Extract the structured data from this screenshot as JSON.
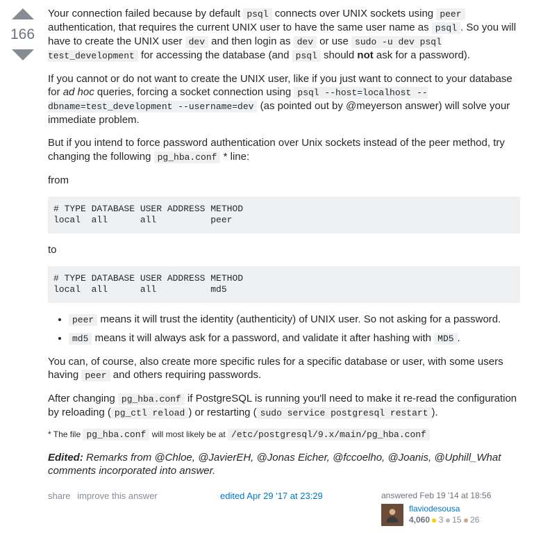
{
  "vote": {
    "count": "166"
  },
  "body": {
    "p1_a": "Your connection failed because by default ",
    "p1_b": " connects over UNIX sockets using ",
    "p1_c": " authentication, that requires the current UNIX user to have the same user name as ",
    "p1_d": ". So you will have to create the UNIX user ",
    "p1_e": " and then login as ",
    "p1_f": " or use ",
    "p1_g": " for accessing the database (and ",
    "p1_h": " should ",
    "p1_not": "not",
    "p1_i": " ask for a password).",
    "p2_a": "If you cannot or do not want to create the UNIX user, like if you just want to connect to your database for ",
    "p2_adhoc": "ad hoc",
    "p2_b": " queries, forcing a socket connection using ",
    "p2_c": " (as pointed out by @meyerson answer) will solve your immediate problem.",
    "p3_a": "But if you intend to force password authentication over Unix sockets instead of the peer method, try changing the following ",
    "p3_b": " * line:",
    "from": "from",
    "to": "to",
    "li1_a": " means it will trust the identity (authenticity) of UNIX user. So not asking for a password.",
    "li2_a": " means it will always ask for a password, and validate it after hashing with ",
    "li2_b": ".",
    "p4_a": "You can, of course, also create more specific rules for a specific database or user, with some users having ",
    "p4_b": " and others requiring passwords.",
    "p5_a": "After changing ",
    "p5_b": " if PostgreSQL is running you'll need to make it re-read the configuration by reloading (",
    "p5_c": ") or restarting (",
    "p5_d": ").",
    "note_a": "* The file ",
    "note_b": " will most likely be at ",
    "edited_label": "Edited:",
    "edited_text": " Remarks from @Chloe, @JavierEH, @Jonas Eicher, @fccoelho, @Joanis, @Uphill_What comments incorporated into answer."
  },
  "codes": {
    "psql": "psql",
    "peer": "peer",
    "dev": "dev",
    "sudo": "sudo -u dev psql test_development",
    "longhost": "psql --host=localhost --dbname=test_development --username=dev",
    "pghba": "pg_hba.conf",
    "md5u": "MD5",
    "md5l": "md5",
    "pgctl": "pg_ctl reload",
    "restart": "sudo service postgresql restart",
    "path": "/etc/postgresql/9.x/main/pg_hba.conf"
  },
  "pre": {
    "from": "# TYPE DATABASE USER ADDRESS METHOD\nlocal  all      all          peer",
    "to": "# TYPE DATABASE USER ADDRESS METHOD\nlocal  all      all          md5"
  },
  "actions": {
    "share": "share",
    "improve": "improve this answer",
    "edited": "edited Apr 29 '17 at 23:29",
    "answered": "answered Feb 19 '14 at 18:56"
  },
  "user": {
    "name": "flaviodesousa",
    "rep": "4,060",
    "gold": "3",
    "silver": "15",
    "bronze": "26"
  }
}
